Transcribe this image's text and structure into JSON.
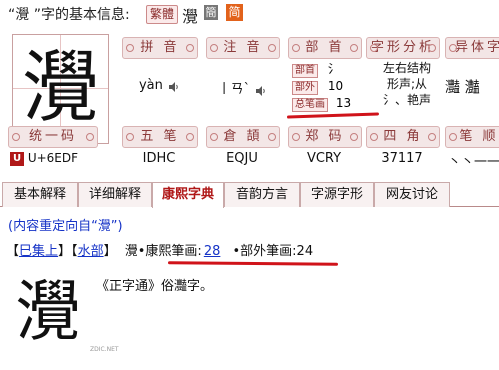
{
  "header": {
    "title": "“灚 ”字的基本信息:",
    "trad_tag": "繁體",
    "trad_char": "灚",
    "simp_tag": "簡",
    "trad_icon": "简"
  },
  "big_char": "灚",
  "info": {
    "pinyin": {
      "label": "拼 音",
      "value": "yàn",
      "icon": "speaker-icon"
    },
    "zhuyin": {
      "label": "注 音",
      "value": "丨ㄢˋ",
      "icon": "speaker-icon"
    },
    "bushou": {
      "label": "部 首",
      "radical_tag": "部首",
      "radical_value": "氵",
      "outer_tag": "部外",
      "outer_value": "10",
      "total_tag": "总笔画",
      "total_value": "13"
    },
    "structure": {
      "label": "字形分析",
      "line1": "左右结构",
      "line2": "形声;从",
      "line3": "氵、艳声"
    },
    "variant": {
      "label": "异体字",
      "value": "灩 灎"
    },
    "unicode": {
      "label": "统一码",
      "value": "U+6EDF",
      "icon_text": "U"
    },
    "wubi": {
      "label": "五 笔",
      "value": "IDHC"
    },
    "cangjie": {
      "label": "倉 頡",
      "value": "EQJU"
    },
    "zhengma": {
      "label": "郑 码",
      "value": "VCRY"
    },
    "sijiao": {
      "label": "四 角",
      "value": "37117"
    },
    "bishun": {
      "label": "笔 顺",
      "value": "丶丶一一一"
    }
  },
  "tabs": [
    "基本解释",
    "详细解释",
    "康熙字典",
    "音韵方言",
    "字源字形",
    "网友讨论"
  ],
  "kangxi": {
    "redirect": "(内容重定向自“灚”)",
    "bracket_open1": "【",
    "ji_link": "巳集上",
    "bracket_close1": "】",
    "bracket_open2": "【",
    "bu_link": "水部",
    "bracket_close2": "】",
    "char": "灚",
    "stroke_label": "•康熙筆画:",
    "stroke_value": "28",
    "outer_label": "•部外筆画:24",
    "big_char": "灚",
    "watermark": "ZDIC.NET",
    "definition": "《正字通》俗灩字。"
  }
}
